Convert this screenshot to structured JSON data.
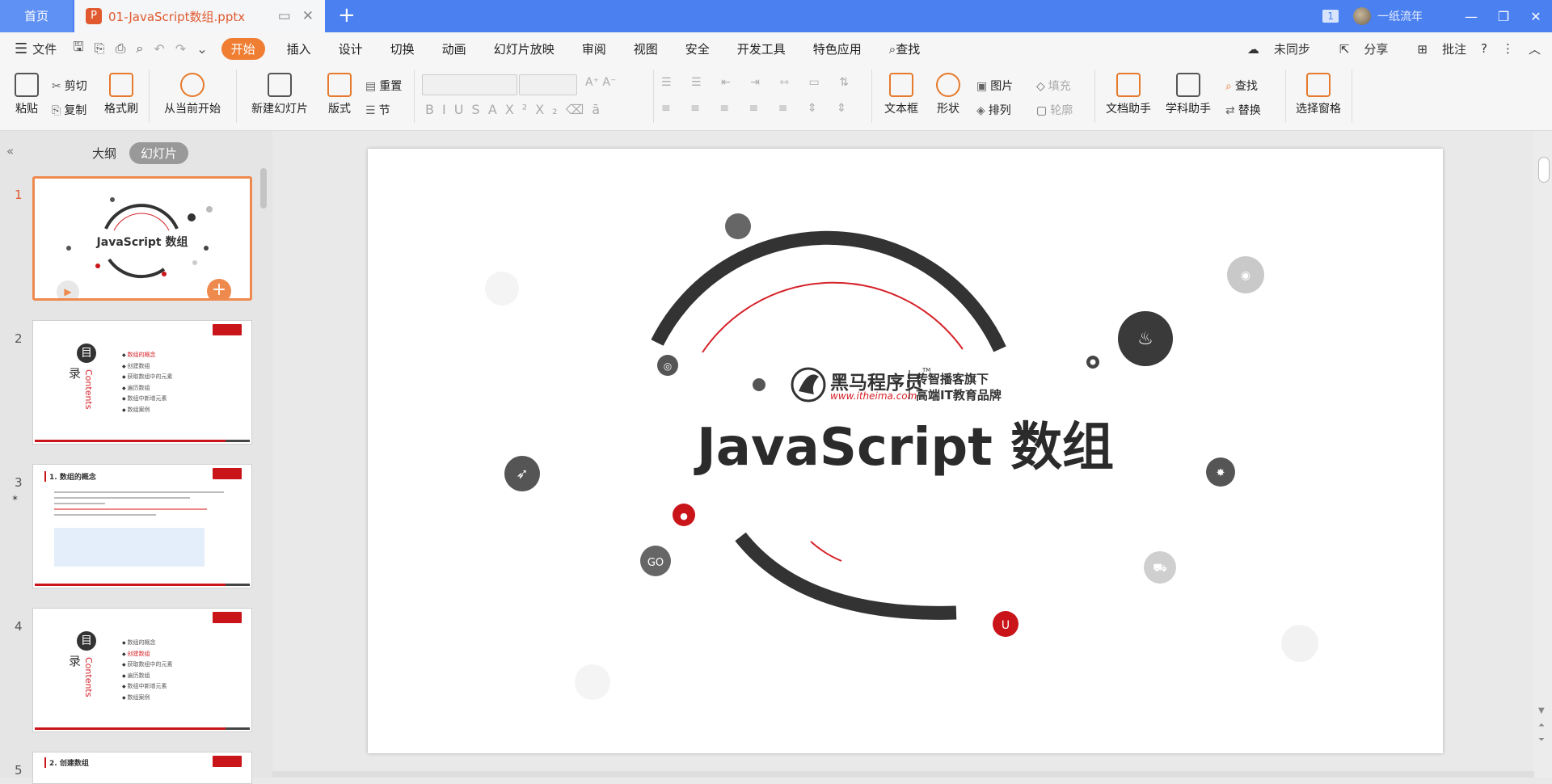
{
  "titlebar": {
    "home_tab": "首页",
    "doc_tab": "01-JavaScript数组.pptx",
    "badge": "1",
    "user": "一纸流年",
    "accent": "#4a80f0"
  },
  "menubar": {
    "file": "文件",
    "tabs": [
      "开始",
      "插入",
      "设计",
      "切换",
      "动画",
      "幻灯片放映",
      "审阅",
      "视图",
      "安全",
      "开发工具",
      "特色应用"
    ],
    "search": "查找",
    "sync": "未同步",
    "share": "分享",
    "comment": "批注",
    "active_color": "#ef7d32"
  },
  "ribbon": {
    "paste": "粘贴",
    "cut": "剪切",
    "copy": "复制",
    "format_painter": "格式刷",
    "from_current": "从当前开始",
    "new_slide": "新建幻灯片",
    "layout": "版式",
    "reset": "重置",
    "section": "节",
    "bold": "B",
    "italic": "I",
    "underline": "U",
    "strike": "S",
    "fill": "填充",
    "outline": "轮廓",
    "textbox": "文本框",
    "shape": "形状",
    "picture": "图片",
    "arrange": "排列",
    "doc_assistant": "文档助手",
    "subject_assistant": "学科助手",
    "find": "查找",
    "replace": "替换",
    "select_pane": "选择窗格"
  },
  "leftpanel": {
    "outline_tab": "大纲",
    "slides_tab": "幻灯片",
    "slides": [
      {
        "num": "1",
        "title": "JavaScript 数组"
      },
      {
        "num": "2",
        "mu": "目",
        "lu": "录",
        "contents": "Contents",
        "items": [
          "数组的概念",
          "创建数组",
          "获取数组中的元素",
          "遍历数组",
          "数组中新增元素",
          "数组案例"
        ]
      },
      {
        "num": "3",
        "title": "1. 数组的概念"
      },
      {
        "num": "4",
        "mu": "目",
        "lu": "录",
        "contents": "Contents",
        "items": [
          "数组的概念",
          "创建数组",
          "获取数组中的元素",
          "遍历数组",
          "数组中新增元素",
          "数组案例"
        ]
      },
      {
        "num": "5",
        "title": "2. 创建数组"
      }
    ]
  },
  "slide": {
    "title": "JavaScript 数组",
    "brand_cn": "黑马程序员",
    "brand_tm": "TM",
    "brand_url": "www.itheima.com",
    "tagline1": "传智播客旗下",
    "tagline2": "高端IT教育品牌",
    "accent_red": "#d5232a",
    "arc_color": "#333333"
  }
}
